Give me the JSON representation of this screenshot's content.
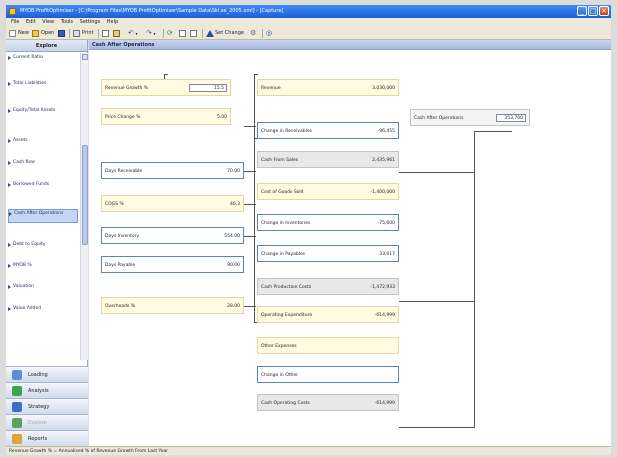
{
  "window": {
    "title": "MYOB ProfitOptimiser - [C:\\Program Files\\MYOB ProfitOptimiser\\Sample Data\\Ski.se_2005.xml] - [Capture]"
  },
  "menu": [
    "File",
    "Edit",
    "View",
    "Tools",
    "Settings",
    "Help"
  ],
  "toolbar": {
    "new_label": "New",
    "open_label": "Open",
    "print_label": "Print",
    "set_change_label": "Set Change"
  },
  "sidebar": {
    "header": "Explore",
    "items": [
      {
        "label": "Current Ratio"
      },
      {
        "label": "Total Liabilities"
      },
      {
        "label": "Equity/Total Assets"
      },
      {
        "label": "Assets"
      },
      {
        "label": "Cash flow"
      },
      {
        "label": "Borrowed Funds"
      },
      {
        "label": "Cash After Operations"
      },
      {
        "label": "Debt to Equity"
      },
      {
        "label": "MYOB %"
      },
      {
        "label": "Valuation"
      },
      {
        "label": "Value Added"
      }
    ],
    "nav": [
      {
        "label": "Loading"
      },
      {
        "label": "Analysis"
      },
      {
        "label": "Strategy"
      },
      {
        "label": "Explore"
      },
      {
        "label": "Reports"
      }
    ]
  },
  "content": {
    "title": "Cash After Operations"
  },
  "diagram": {
    "revenue_growth": {
      "label": "Revenue Growth %",
      "value": "15.5"
    },
    "price_change": {
      "label": "Price Change %",
      "value": "5.00"
    },
    "days_receivable": {
      "label": "Days Receivable",
      "value": "70.00"
    },
    "cogs": {
      "label": "COGS %",
      "value": "46.3"
    },
    "days_inventory": {
      "label": "Days Inventory",
      "value": "554.00"
    },
    "days_payable": {
      "label": "Days Payable",
      "value": "90.00"
    },
    "overheads": {
      "label": "Overheads %",
      "value": "28.00"
    },
    "revenue": {
      "label": "Revenue",
      "value": "3,030,000"
    },
    "change_receivables": {
      "label": "Change in Receivables",
      "value": "-96,455"
    },
    "cash_from_sales": {
      "label": "Cash From Sales",
      "value": "2,435,961"
    },
    "cost_goods_sold": {
      "label": "Cost of Goods Sold",
      "value": "-1,400,000"
    },
    "change_inventories": {
      "label": "Change in Inventories",
      "value": "-75,600"
    },
    "change_payables": {
      "label": "Change in Payables",
      "value": "33,017"
    },
    "cash_production_costs": {
      "label": "Cash Production Costs",
      "value": "-1,472,933"
    },
    "operating_expenditure": {
      "label": "Operating Expenditure",
      "value": "-614,999"
    },
    "other_expenses": {
      "label": "Other Expenses",
      "value": ""
    },
    "change_other": {
      "label": "Change in Other",
      "value": ""
    },
    "cash_operating_costs": {
      "label": "Cash Operating Costs",
      "value": "-614,999"
    },
    "cash_after_operations": {
      "label": "Cash After Operations",
      "value": "353,760"
    }
  },
  "statusbar": {
    "text": "Revenue Growth % = Annualised % of Revenue Growth From Last Year"
  },
  "colors": {
    "accent_blue": "#1c5ed6",
    "input_box": "#fffae0",
    "calc_box": "#e8e8e8"
  }
}
